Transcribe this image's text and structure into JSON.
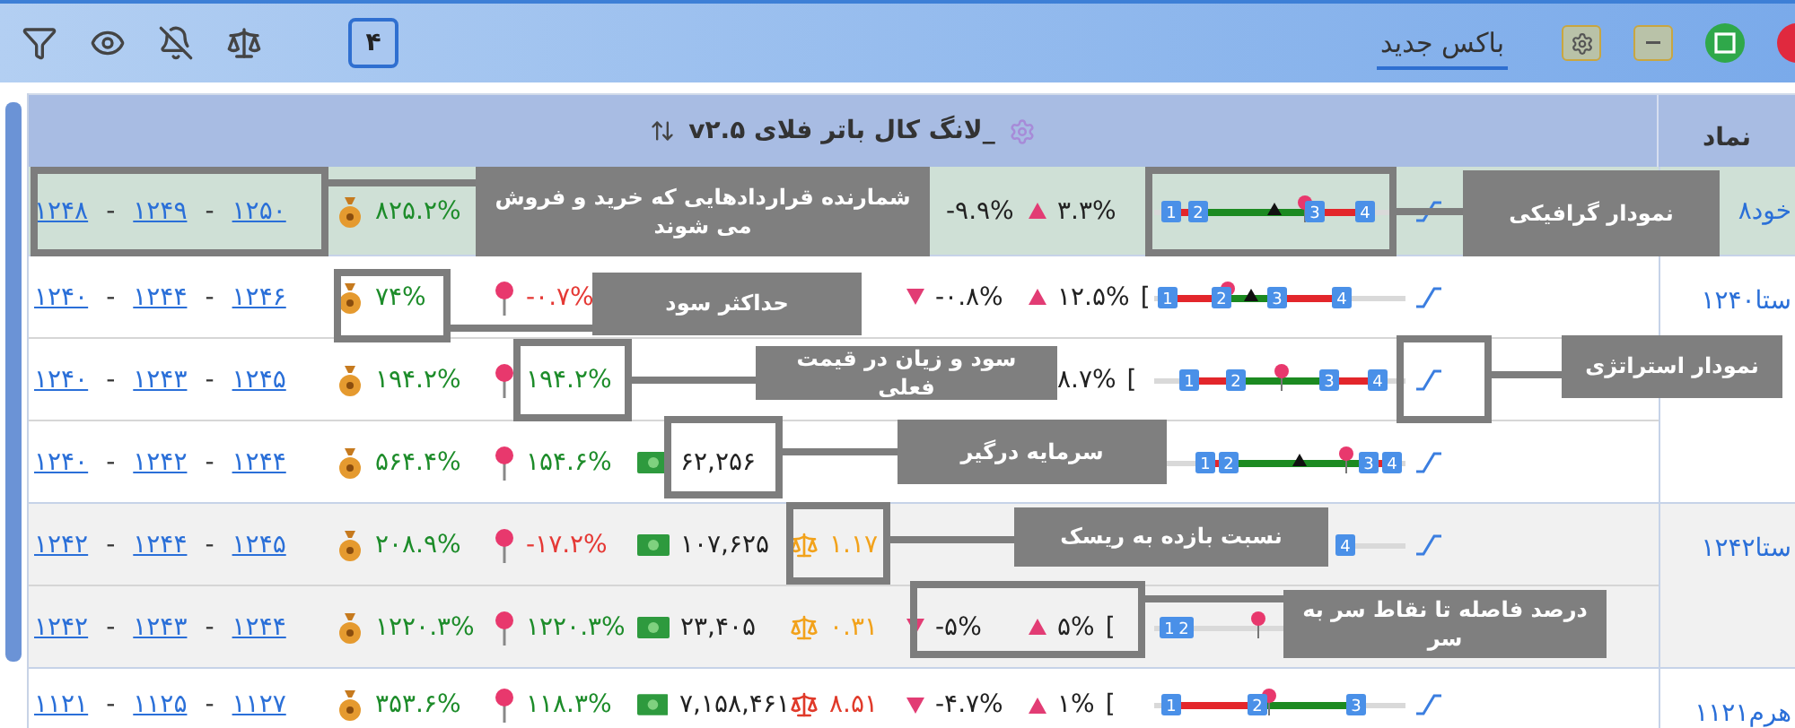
{
  "toolbar": {
    "badge": "۴",
    "tab": {
      "label": "باکس جدید",
      "selected": true
    }
  },
  "table": {
    "title": "_لانگ کال باتر فلای v۲.۵",
    "symbol_header": "نماد",
    "groups": [
      {
        "symbol": "خود۸",
        "selected": true,
        "hovered": false,
        "rows": [
          {
            "contracts": [
              {
                "number": "۱۲۵۰"
              },
              {
                "separator": "-",
                "number": "۱۲۴۹"
              },
              {
                "separator": "-",
                "number": "۱۲۴۸"
              }
            ],
            "max_profit": "۸۲۵.۲%",
            "down": "-۹.۹%",
            "up": "۳.۳%",
            "markers": [
              "4",
              "3",
              "2",
              "1"
            ]
          }
        ]
      },
      {
        "symbol": "ستا۱۲۴۰",
        "selected": false,
        "hovered": false,
        "rows": [
          {
            "contracts": [
              {
                "number": "۱۲۴۶"
              },
              {
                "separator": "-",
                "number": "۱۲۴۴"
              },
              {
                "separator": "-",
                "number": "۱۲۴۰"
              }
            ],
            "max_profit": "۷۴%",
            "pnl": "-۰.۷%",
            "pnl_loss": true,
            "down": "-۰.۸%",
            "up": "۱۲.۵%",
            "bracket": "[",
            "markers": [
              "4",
              "3",
              "2",
              "1"
            ]
          },
          {
            "contracts": [
              {
                "number": "۱۲۴۵"
              },
              {
                "separator": "-",
                "number": "۱۲۴۳"
              },
              {
                "separator": "-",
                "number": "۱۲۴۰"
              }
            ],
            "max_profit": "۱۹۴.۲%",
            "pnl": "۱۹۴.۲%",
            "pnl_loss": false,
            "up": "۸.۷%",
            "bracket": "[",
            "markers": [
              "4",
              "3",
              "2",
              "1"
            ]
          },
          {
            "contracts": [
              {
                "number": "۱۲۴۴"
              },
              {
                "separator": "-",
                "number": "۱۲۴۲"
              },
              {
                "separator": "-",
                "number": "۱۲۴۰"
              }
            ],
            "max_profit": "۵۶۴.۴%",
            "pnl": "۱۵۴.۶%",
            "pnl_loss": false,
            "capital": "۶۲,۲۵۶",
            "markers": [
              "4",
              "3",
              "2",
              "1"
            ]
          }
        ]
      },
      {
        "symbol": "ستا۱۲۴۲",
        "selected": false,
        "hovered": true,
        "rows": [
          {
            "contracts": [
              {
                "number": "۱۲۴۵"
              },
              {
                "separator": "-",
                "number": "۱۲۴۴"
              },
              {
                "separator": "-",
                "number": "۱۲۴۲"
              }
            ],
            "max_profit": "۲۰۸.۹%",
            "pnl": "-۱۷.۲%",
            "pnl_loss": true,
            "capital": "۱۰۷,۶۲۵",
            "reward_risk": "۱.۱۷",
            "risk_high": false,
            "markers": [
              "4"
            ]
          },
          {
            "contracts": [
              {
                "number": "۱۲۴۴"
              },
              {
                "separator": "-",
                "number": "۱۲۴۳"
              },
              {
                "separator": "-",
                "number": "۱۲۴۲"
              }
            ],
            "max_profit": "۱۲۲۰.۳%",
            "pnl": "۱۲۲۰.۳%",
            "pnl_loss": false,
            "capital": "۲۳,۴۰۵",
            "reward_risk": "۰.۳۱",
            "risk_high": false,
            "down": "-۵%",
            "up": "۵%",
            "bracket": "[",
            "markers": [
              "2",
              "1"
            ]
          }
        ]
      },
      {
        "symbol": "هرم۱۱۲۱",
        "selected": false,
        "hovered": false,
        "rows": [
          {
            "contracts": [
              {
                "number": "۱۱۲۷"
              },
              {
                "separator": "-",
                "number": "۱۱۲۵"
              },
              {
                "separator": "-",
                "number": "۱۱۲۱"
              }
            ],
            "max_profit": "۳۵۳.۶%",
            "pnl": "۱۱۸.۳%",
            "pnl_loss": false,
            "capital": "۷,۱۵۸,۴۶۱",
            "reward_risk": "۸.۵۱",
            "risk_high": true,
            "down": "-۴.۷%",
            "up": "۱%",
            "bracket": "[",
            "markers": [
              "3",
              "2",
              "1"
            ]
          }
        ]
      }
    ]
  },
  "callouts": [
    {
      "text": "شمارنده قراردادهایی که خرید و فروش می شوند"
    },
    {
      "text": "حداکثر سود"
    },
    {
      "text": "سود و زیان در قیمت فعلی"
    },
    {
      "text": "سرمایه درگیر"
    },
    {
      "text": "نمودار گرافیکی"
    },
    {
      "text": "نمودار استراتژی"
    },
    {
      "text": "نسبت بازده به ریسک"
    },
    {
      "text": "درصد فاصله تا نقاط سر به سر"
    }
  ]
}
